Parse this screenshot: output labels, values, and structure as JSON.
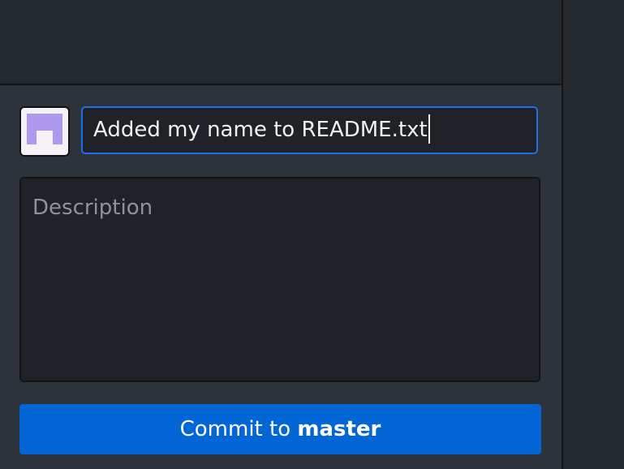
{
  "commit": {
    "summary_value": "Added my name to README.txt",
    "description_placeholder": "Description",
    "button_prefix": "Commit to ",
    "button_branch": "master"
  },
  "colors": {
    "accent": "#0366d6",
    "focus_border": "#1f6feb",
    "avatar_color": "#ad99ee"
  }
}
